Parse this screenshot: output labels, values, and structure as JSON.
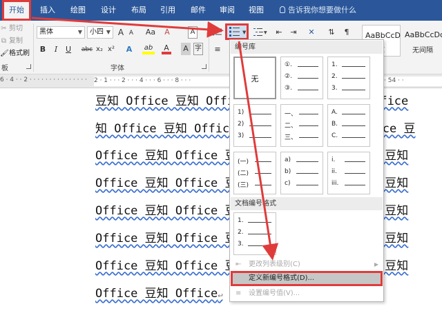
{
  "tabs": [
    "开始",
    "插入",
    "绘图",
    "设计",
    "布局",
    "引用",
    "邮件",
    "审阅",
    "视图"
  ],
  "tell_me": "告诉我你想要做什么",
  "clipboard": {
    "cut": "剪切",
    "copy": "复制",
    "format_painter": "格式刷",
    "group": "板"
  },
  "font": {
    "name": "黑体",
    "size": "小四",
    "grow": "A",
    "shrink": "A",
    "case": "Aa",
    "bold": "B",
    "italic": "I",
    "underline": "U",
    "strike": "abc",
    "subscript": "x₂",
    "superscript": "x²",
    "effects": "A",
    "highlight": "ab",
    "color": "A",
    "shade": "A",
    "group": "字体"
  },
  "styles": [
    {
      "sample": "AaBbCcDc",
      "name": "文"
    },
    {
      "sample": "AaBbCcDc",
      "name": "无间隔"
    }
  ],
  "ruler": "2 · 1 · · · 2 · · · 4 · · · 6 · · · 8 · · ·",
  "ruler_right": "52 · · 54 · ·",
  "document": {
    "lines": [
      "豆知 Office 豆知 Office 豆知 Office 豆知 Office",
      "知 Office 豆知 Office 豆知 Office 豆知 Office 豆",
      "Office 豆知 Office 豆知 Office 豆知 Office 豆知",
      "Office 豆知 Office 豆知 Office 豆知 Office 豆知",
      "Office 豆知 Office 豆知 Office 豆知 Office 豆知",
      "Office 豆知 Office 豆知 Office 豆知 Office 豆知",
      "Office 豆知 Office 豆知 Office 豆知 Office 豆知",
      "Office 豆知 Office"
    ],
    "paragraph_mark": "↵"
  },
  "numbering_panel": {
    "library_title": "编号库",
    "none_label": "无",
    "formats": [
      [
        "①.",
        "②.",
        "③."
      ],
      [
        "1.",
        "2.",
        "3."
      ],
      [
        "1)",
        "2)",
        "3)"
      ],
      [
        "一、",
        "二、",
        "三、"
      ],
      [
        "A.",
        "B.",
        "C."
      ],
      [
        "(一)",
        "(二)",
        "(三)"
      ],
      [
        "a)",
        "b)",
        "c)"
      ],
      [
        "i.",
        "ii.",
        "iii."
      ]
    ],
    "document_title": "文档编号格式",
    "document_format": [
      "1.",
      "2.",
      "3."
    ],
    "menu": {
      "change_level": "更改列表级别(C)",
      "define_new": "定义新编号格式(D)...",
      "set_value": "设置编号值(V)..."
    }
  },
  "colors": {
    "ribbon_blue": "#2b579a",
    "highlight_red": "#e03b3b",
    "arrow_red": "#e03b3b"
  }
}
